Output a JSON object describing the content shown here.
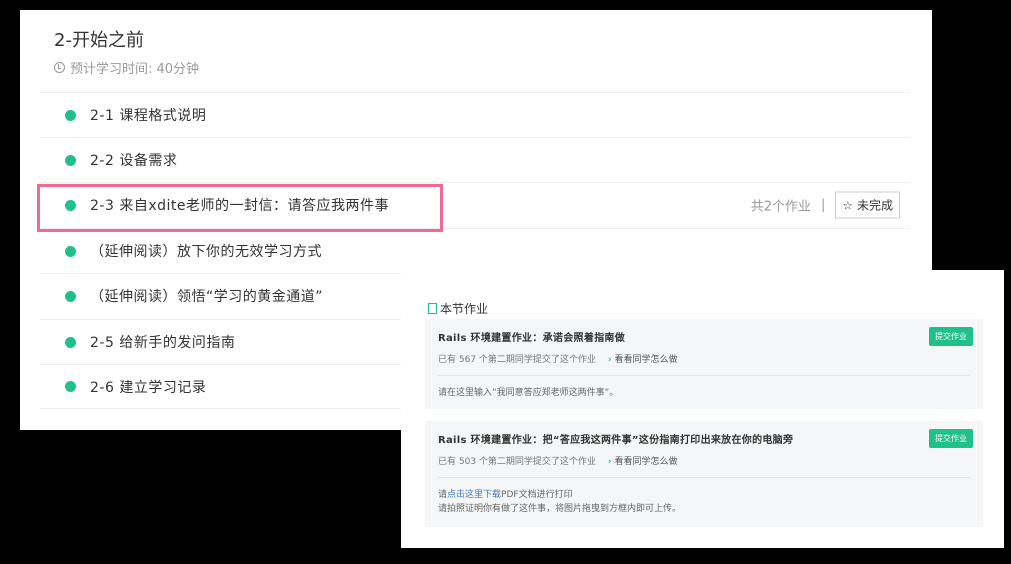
{
  "section": {
    "title": "2-开始之前",
    "time": "预计学习时间: 40分钟"
  },
  "lessons": [
    {
      "label": "2-1 课程格式说明"
    },
    {
      "label": "2-2 设备需求"
    },
    {
      "label": "2-3 来自xdite老师的一封信：请答应我两件事",
      "count": "共2个作业",
      "sep": "|",
      "status": "未完成"
    },
    {
      "label": "（延伸阅读）放下你的无效学习方式"
    },
    {
      "label": "（延伸阅读）领悟“学习的黄金通道”"
    },
    {
      "label": "2-5 给新手的发问指南"
    },
    {
      "label": "2-6 建立学习记录"
    }
  ],
  "homework": {
    "header": "本节作业",
    "items": [
      {
        "title": "Rails 环境建置作业：承诺会照着指南做",
        "submitted": "已有 567 个第二期同学提交了这个作业",
        "link": "看看同学怎么做",
        "button": "提交作业",
        "desc": "请在这里输入“我同意答应郑老师这两件事”。"
      },
      {
        "title": "Rails 环境建置作业：把“答应我这两件事”这份指南打印出来放在你的电脑旁",
        "submitted": "已有 503 个第二期同学提交了这个作业",
        "link": "看看同学怎么做",
        "button": "提交作业",
        "desc_pre": "请",
        "desc_link": "点击这里下载",
        "desc_post": "PDF文档进行打印",
        "desc2": "请拍照证明你有做了这件事，将图片拖曳到方框内即可上传。"
      }
    ]
  },
  "colors": {
    "accent": "#1fc18b",
    "highlight": "#f06b92"
  }
}
